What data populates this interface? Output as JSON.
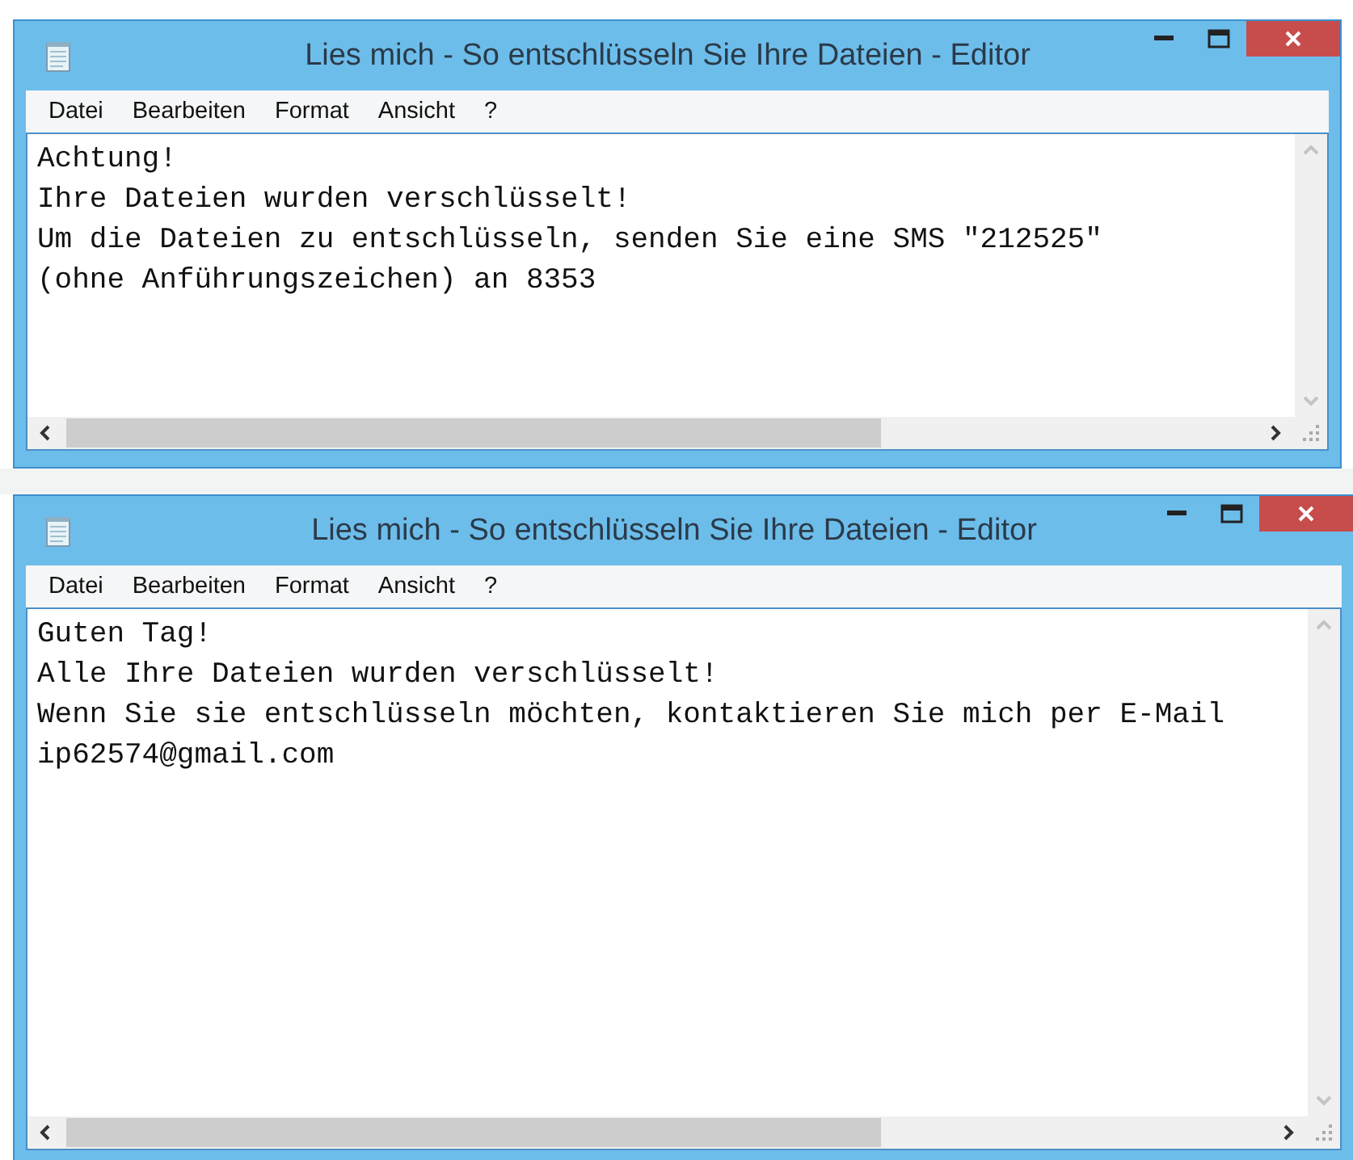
{
  "windows": [
    {
      "title": "Lies mich - So entschlüsseln Sie Ihre Dateien - Editor",
      "menu": [
        "Datei",
        "Bearbeiten",
        "Format",
        "Ansicht",
        "?"
      ],
      "lines": [
        "Achtung!",
        "Ihre Dateien wurden verschlüsselt!",
        "Um die Dateien zu entschlüsseln, senden Sie eine SMS \"212525\"",
        "(ohne Anführungszeichen) an 8353"
      ]
    },
    {
      "title": "Lies mich - So entschlüsseln Sie Ihre Dateien - Editor",
      "menu": [
        "Datei",
        "Bearbeiten",
        "Format",
        "Ansicht",
        "?"
      ],
      "lines": [
        "Guten Tag!",
        "Alle Ihre Dateien wurden verschlüsselt!",
        "Wenn Sie sie entschlüsseln möchten, kontaktieren Sie mich per E-Mail",
        "ip62574@gmail.com"
      ]
    }
  ]
}
